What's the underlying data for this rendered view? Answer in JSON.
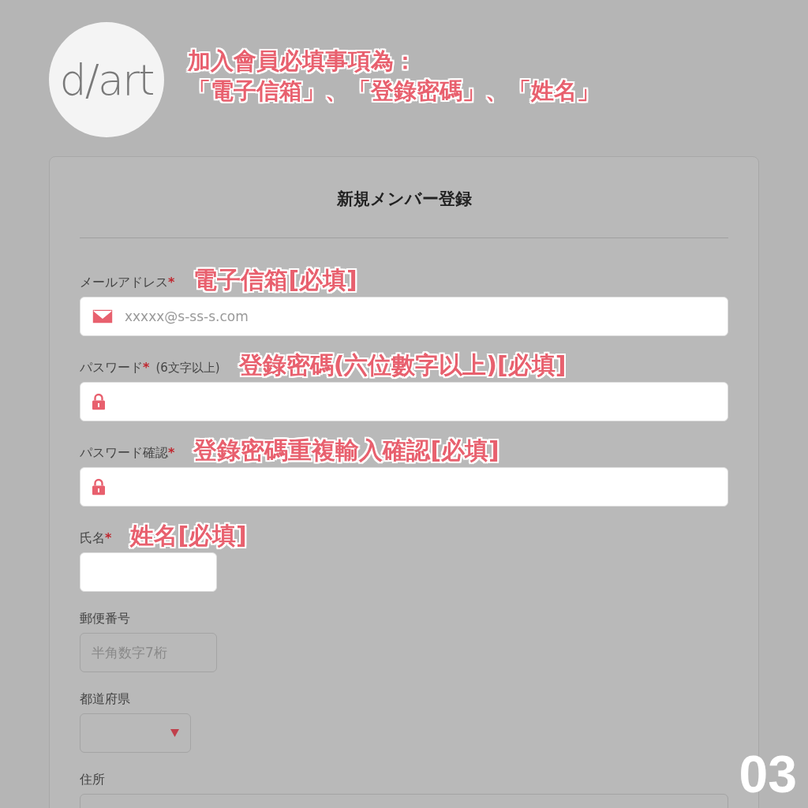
{
  "logo": {
    "text": "d/art"
  },
  "headline": [
    "加入會員必填事項為：",
    "「電子信箱」、「登錄密碼」、「姓名」"
  ],
  "form": {
    "title": "新規メンバー登録",
    "fields": [
      {
        "kind": "email",
        "label": "メールアドレス",
        "asterisk": "*",
        "annotation": "電子信箱[必填]",
        "placeholder": "xxxxx@s-ss-s.com",
        "highlighted": true
      },
      {
        "kind": "password",
        "label": "パスワード",
        "asterisk": "*",
        "note": "(6文字以上)",
        "annotation": "登錄密碼(六位數字以上)[必填]",
        "highlighted": true
      },
      {
        "kind": "password",
        "label": "パスワード確認",
        "asterisk": "*",
        "annotation": "登錄密碼重複輸入確認[必填]",
        "highlighted": true
      },
      {
        "kind": "name",
        "label": "氏名",
        "asterisk": "*",
        "annotation": "姓名[必填]",
        "highlighted": true
      },
      {
        "kind": "postal",
        "label": "郵便番号",
        "placeholder": "半角数字7桁",
        "highlighted": false
      },
      {
        "kind": "select",
        "label": "都道府県",
        "highlighted": false
      },
      {
        "kind": "address",
        "label": "住所",
        "highlighted": false
      }
    ]
  },
  "page_number": "03"
}
